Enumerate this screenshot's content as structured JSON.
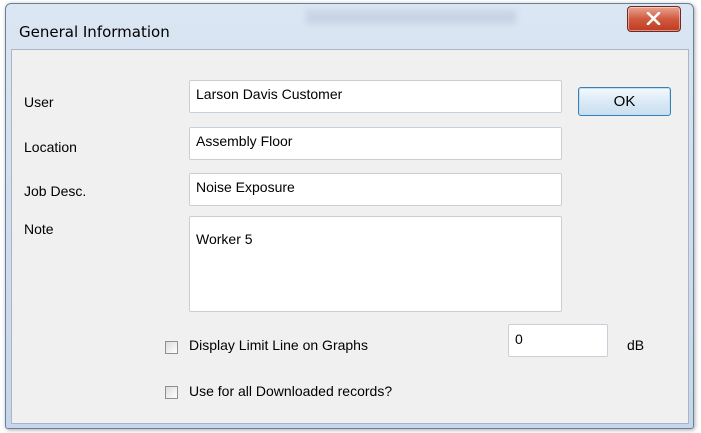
{
  "window": {
    "title": "General Information",
    "close_icon": "close-x-icon"
  },
  "form": {
    "user_label": "User",
    "user_value": "Larson Davis Customer",
    "location_label": "Location",
    "location_value": "Assembly Floor",
    "job_label": "Job Desc.",
    "job_value": "Noise Exposure",
    "note_label": "Note",
    "note_value": "Worker 5",
    "ok_label": "OK",
    "limit_line_label": "Display Limit Line on Graphs",
    "limit_line_checked": false,
    "limit_value": "0",
    "limit_unit": "dB",
    "use_all_label": "Use for all Downloaded records?",
    "use_all_checked": false
  }
}
